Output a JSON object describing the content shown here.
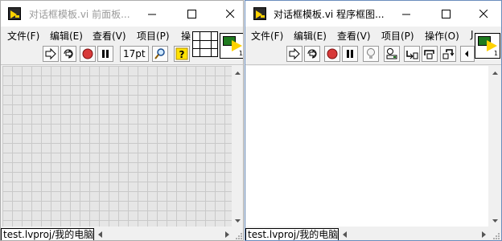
{
  "front_panel": {
    "title": "对话框模板.vi 前面板...",
    "menu": [
      "文件(F)",
      "编辑(E)",
      "查看(V)",
      "项目(P)",
      "操"
    ],
    "font_size_label": "17pt",
    "status_text": "test.lvproj/我的电脑",
    "connector_number": "1"
  },
  "block_diagram": {
    "title": "对话框模板.vi 程序框图...",
    "menu": [
      "文件(F)",
      "编辑(E)",
      "查看(V)",
      "项目(P)",
      "操作(O)",
      "J"
    ],
    "status_text": "test.lvproj/我的电脑",
    "connector_number": "1"
  },
  "icons": {
    "run": "run-arrow-icon",
    "run_continuous": "run-continuously-icon",
    "abort": "abort-icon",
    "pause": "pause-icon",
    "highlight": "highlight-execution-icon",
    "probe": "retain-wire-values-icon",
    "step_into": "step-into-icon",
    "step_over": "step-over-icon",
    "step_out": "step-out-icon",
    "search": "search-icon",
    "help": "help-icon"
  },
  "colors": {
    "accent_border": "#6a8dbd",
    "abort_red": "#d83a3a",
    "grid_bg": "#e6e6e6",
    "grid_line": "#c9c9c9",
    "help_yellow": "#ffe100"
  }
}
